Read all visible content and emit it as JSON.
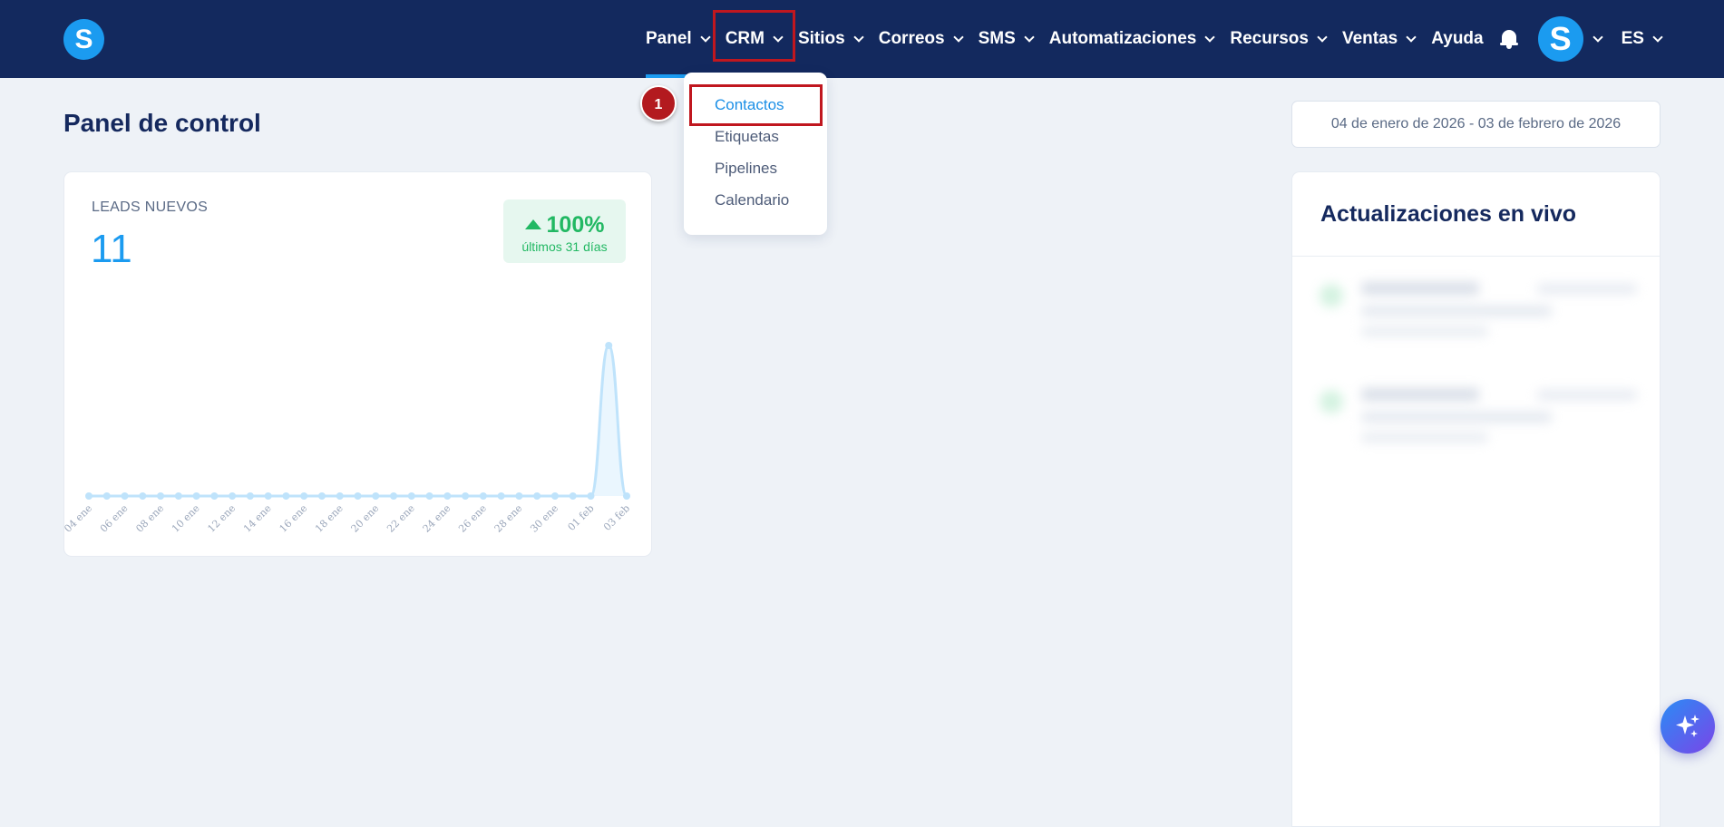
{
  "app": {
    "logo_letter": "S"
  },
  "nav": {
    "items": [
      {
        "label": "Panel"
      },
      {
        "label": "CRM"
      },
      {
        "label": "Sitios"
      },
      {
        "label": "Correos"
      },
      {
        "label": "SMS"
      },
      {
        "label": "Automatizaciones"
      },
      {
        "label": "Recursos"
      },
      {
        "label": "Ventas"
      }
    ],
    "help_label": "Ayuda",
    "avatar_letter": "S",
    "language": "ES"
  },
  "crm_menu": {
    "items": [
      {
        "label": "Contactos"
      },
      {
        "label": "Etiquetas"
      },
      {
        "label": "Pipelines"
      },
      {
        "label": "Calendario"
      }
    ],
    "step_badge": "1"
  },
  "page": {
    "title": "Panel de control",
    "date_range": "04 de enero de 2026 - 03 de febrero de 2026"
  },
  "leads_card": {
    "label": "LEADS NUEVOS",
    "value": "11",
    "trend_pct": "100%",
    "trend_sub": "últimos 31 días"
  },
  "chart_data": {
    "type": "area",
    "title": "",
    "xlabel": "",
    "ylabel": "",
    "tick_labels": [
      "04 ene",
      "06 ene",
      "08 ene",
      "10 ene",
      "12 ene",
      "14 ene",
      "16 ene",
      "18 ene",
      "20 ene",
      "22 ene",
      "24 ene",
      "26 ene",
      "28 ene",
      "30 ene",
      "01 feb",
      "03 feb"
    ],
    "x": [
      "04 ene",
      "05 ene",
      "06 ene",
      "07 ene",
      "08 ene",
      "09 ene",
      "10 ene",
      "11 ene",
      "12 ene",
      "13 ene",
      "14 ene",
      "15 ene",
      "16 ene",
      "17 ene",
      "18 ene",
      "19 ene",
      "20 ene",
      "21 ene",
      "22 ene",
      "23 ene",
      "24 ene",
      "25 ene",
      "26 ene",
      "27 ene",
      "28 ene",
      "29 ene",
      "30 ene",
      "31 ene",
      "01 feb",
      "02 feb",
      "03 feb"
    ],
    "values": [
      0,
      0,
      0,
      0,
      0,
      0,
      0,
      0,
      0,
      0,
      0,
      0,
      0,
      0,
      0,
      0,
      0,
      0,
      0,
      0,
      0,
      0,
      0,
      0,
      0,
      0,
      0,
      0,
      0,
      11,
      0
    ],
    "ylim": [
      0,
      12
    ],
    "grid": false,
    "color": "#bfe3fb"
  },
  "live_updates": {
    "title": "Actualizaciones en vivo"
  },
  "colors": {
    "topbar": "#13295e",
    "accent": "#1b9bf0",
    "highlight": "#c0171f",
    "success": "#22b863"
  },
  "icons": {
    "bell": "bell-icon",
    "chevron": "chevron-down-icon",
    "sparkle": "sparkle-icon"
  }
}
